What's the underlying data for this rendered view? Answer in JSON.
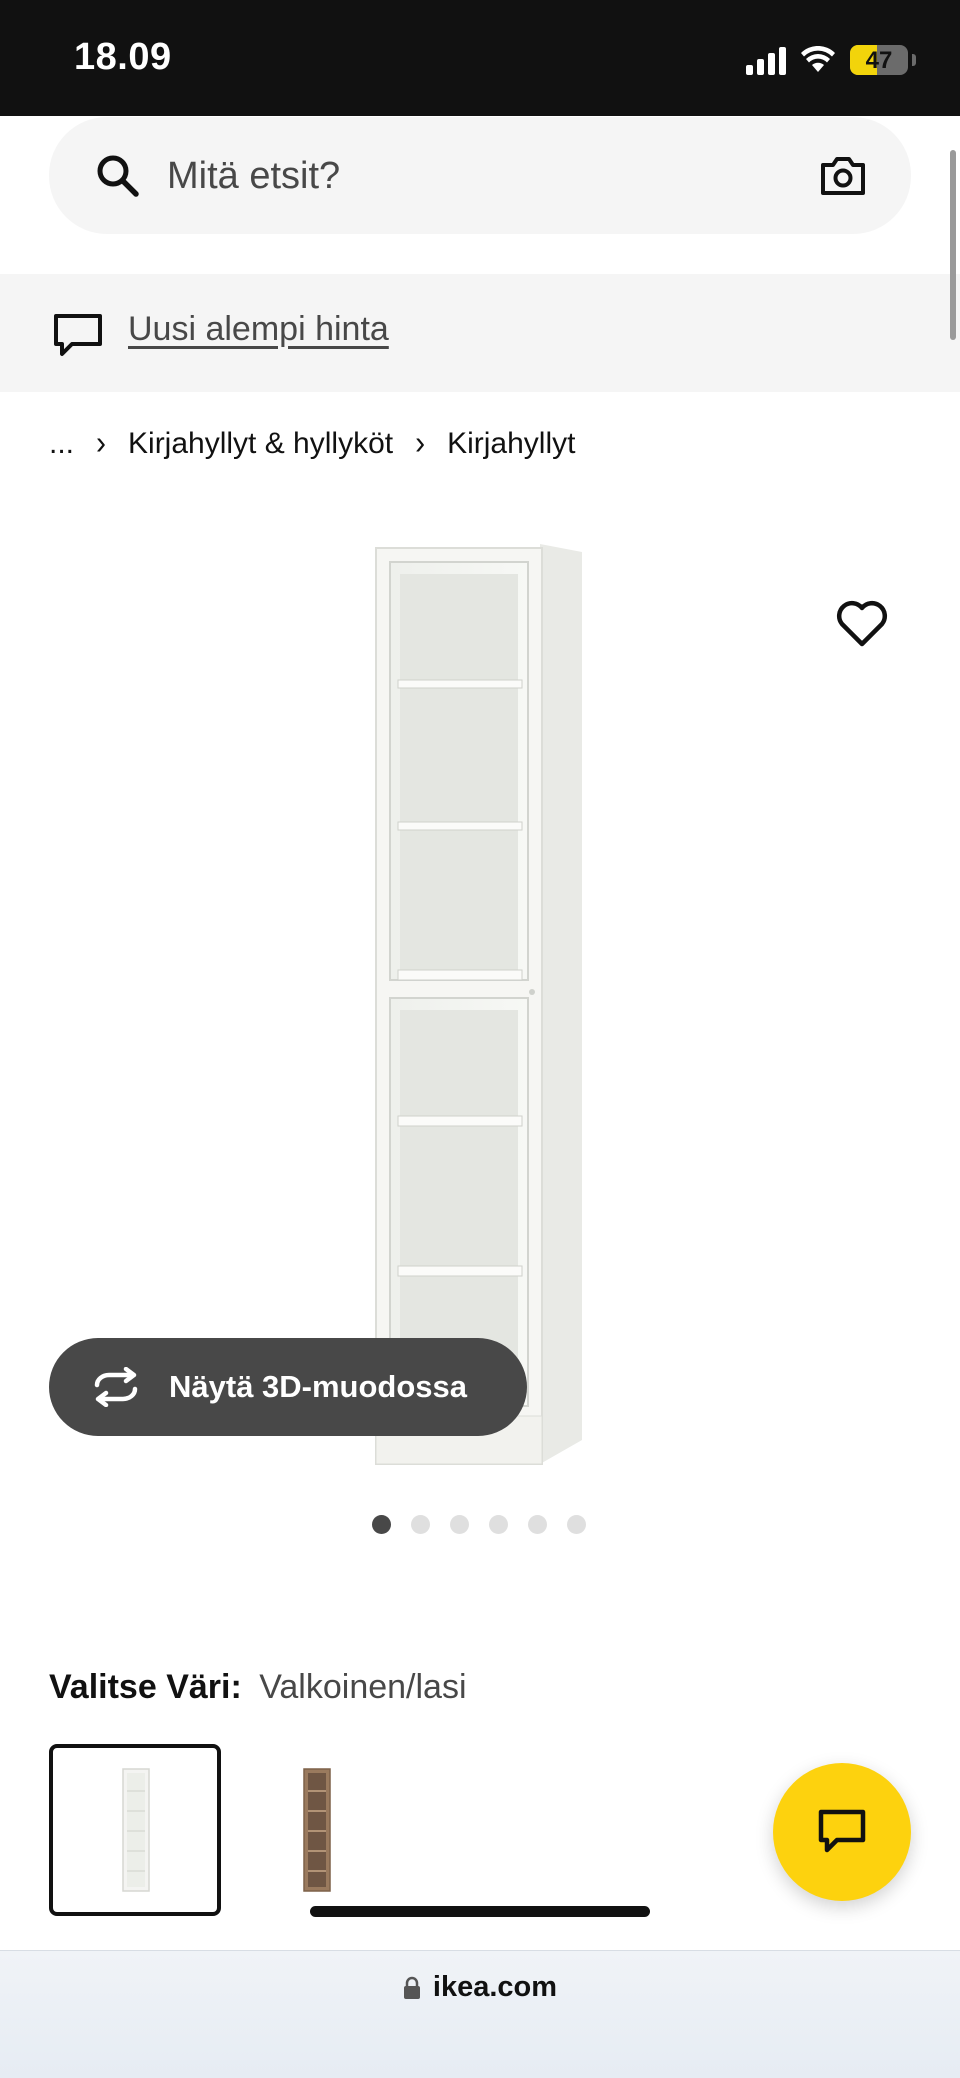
{
  "status_bar": {
    "time": "18.09",
    "battery": "47"
  },
  "search": {
    "placeholder": "Mitä etsit?"
  },
  "banner": {
    "link_text": "Uusi alempi hinta"
  },
  "breadcrumb": {
    "ellipsis": "...",
    "items": [
      "Kirjahyllyt & hyllyköt",
      "Kirjahyllyt"
    ],
    "separator": "›"
  },
  "product": {
    "view_3d_label": "Näytä 3D-muodossa",
    "image_count": 6,
    "active_image": 1
  },
  "color_selector": {
    "label": "Valitse Väri:",
    "value": "Valkoinen/lasi",
    "options": [
      {
        "name": "Valkoinen/lasi",
        "selected": true,
        "color": "#f4f4f2"
      },
      {
        "name": "ruskea",
        "selected": false,
        "color": "#9a7a5e"
      }
    ]
  },
  "browser": {
    "url": "ikea.com"
  },
  "colors": {
    "accent_yellow": "#fdd20e",
    "dark_button": "#484848"
  }
}
